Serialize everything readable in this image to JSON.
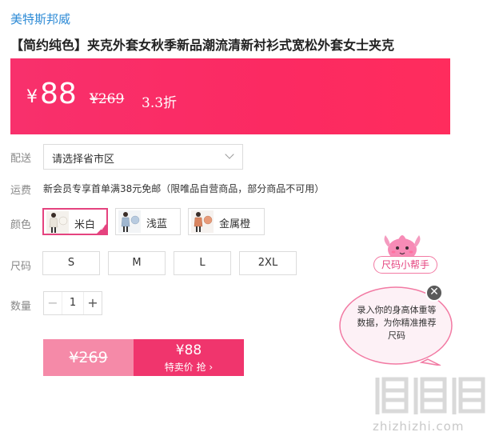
{
  "brand": "美特斯邦威",
  "title": "【简约纯色】夹克外套女秋季新品潮流清新衬衫式宽松外套女士夹克",
  "price": {
    "currency": "¥",
    "current": "88",
    "original": "¥269",
    "discount": "3.3折"
  },
  "delivery": {
    "label": "配送",
    "placeholder": "请选择省市区"
  },
  "shipping": {
    "label": "运费",
    "text": "新会员专享首单满38元免邮（限唯品自营商品，部分商品不可用）"
  },
  "colors": {
    "label": "颜色",
    "options": [
      "米白",
      "浅蓝",
      "金属橙"
    ],
    "selected": "米白"
  },
  "sizes": {
    "label": "尺码",
    "options": [
      "S",
      "M",
      "L",
      "2XL"
    ]
  },
  "quantity": {
    "label": "数量",
    "value": "1",
    "minus": "−",
    "plus": "+"
  },
  "buy_button": {
    "original": "¥269",
    "price": "¥88",
    "action": "特卖价 抢 ›"
  },
  "size_helper": {
    "title": "尺码小帮手",
    "text": "录入你的身高体重等数据，为你精准推荐尺码",
    "close": "✕"
  },
  "watermark": {
    "text": "zhizhizhi.com"
  },
  "colors_theme": {
    "brand_link": "#2e8bd6",
    "price_banner": "#fb2a62",
    "accent": "#e5437f",
    "buy_right": "#f0356d",
    "buy_left": "#f58aa8"
  }
}
